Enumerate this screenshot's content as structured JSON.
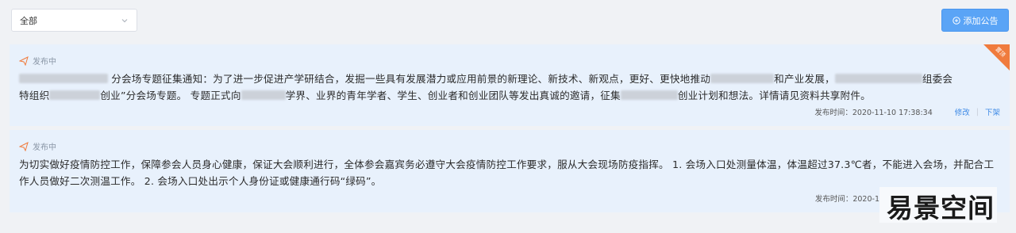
{
  "filter": {
    "selected": "全部"
  },
  "toolbar": {
    "add_label": "添加公告"
  },
  "notices": [
    {
      "status": "发布中",
      "badge": "置顶",
      "content_parts": [
        "分会场专题征集通知：为了进一步促进产学研结合，发掘一些具有发展潜力或应用前景的新理论、新技术、新观点，更好、更快地推动",
        "和产业发展，",
        "组委会",
        "特组织",
        "创业”分会场专题。 专题正式向",
        "学界、业界的青年学者、学生、创业者和创业团队等发出真诚的邀请，征集",
        "创业计划和想法。详情请见资料共享附件。"
      ],
      "publish_label": "发布时间：2020-11-10 17:38:34",
      "edit": "修改",
      "offline": "下架"
    },
    {
      "status": "发布中",
      "content": "为切实做好疫情防控工作，保障参会人员身心健康，保证大会顺利进行，全体参会嘉宾务必遵守大会疫情防控工作要求，服从大会现场防疫指挥。 1. 会场入口处测量体温，体温超过37.3℃者，不能进入会场，并配合工作人员做好二次测温工作。 2. 会场入口处出示个人身份证或健康通行码“绿码”。",
      "publish_label": "发布时间：2020-1"
    }
  ],
  "watermark": "易景空间"
}
